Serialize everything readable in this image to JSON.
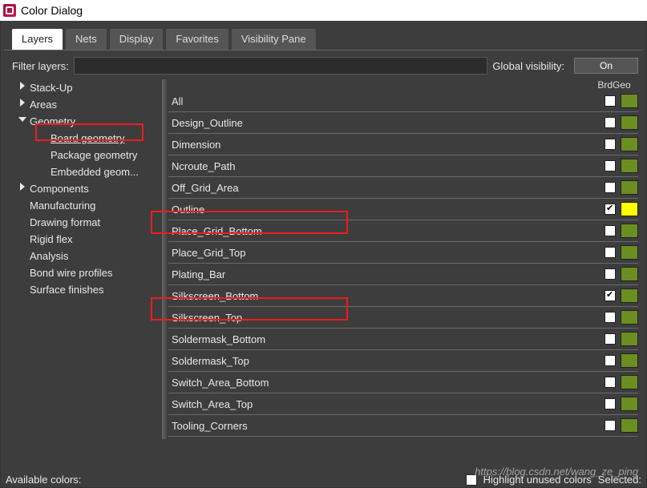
{
  "window": {
    "title": "Color Dialog"
  },
  "tabs": [
    "Layers",
    "Nets",
    "Display",
    "Favorites",
    "Visibility Pane"
  ],
  "active_tab": "Layers",
  "filter": {
    "label": "Filter layers:",
    "value": ""
  },
  "global_visibility": {
    "label": "Global visibility:",
    "button": "On"
  },
  "tree": [
    {
      "label": "Stack-Up",
      "arrow": "right",
      "level": 0
    },
    {
      "label": "Areas",
      "arrow": "right",
      "level": 0
    },
    {
      "label": "Geometry",
      "arrow": "down",
      "level": 0
    },
    {
      "label": "Board geometry",
      "arrow": "",
      "level": 1,
      "selected": true
    },
    {
      "label": "Package geometry",
      "arrow": "",
      "level": 1
    },
    {
      "label": "Embedded geom...",
      "arrow": "",
      "level": 1
    },
    {
      "label": "Components",
      "arrow": "right",
      "level": 0
    },
    {
      "label": "Manufacturing",
      "arrow": "",
      "level": 0
    },
    {
      "label": "Drawing format",
      "arrow": "",
      "level": 0
    },
    {
      "label": "Rigid flex",
      "arrow": "",
      "level": 0
    },
    {
      "label": "Analysis",
      "arrow": "",
      "level": 0
    },
    {
      "label": "Bond wire profiles",
      "arrow": "",
      "level": 0
    },
    {
      "label": "Surface finishes",
      "arrow": "",
      "level": 0
    }
  ],
  "column_header": "BrdGeo",
  "layers": [
    {
      "name": "All",
      "color": "#6b8e23",
      "checked": false
    },
    {
      "name": "Design_Outline",
      "color": "#6b8e23",
      "checked": false
    },
    {
      "name": "Dimension",
      "color": "#6b8e23",
      "checked": false
    },
    {
      "name": "Ncroute_Path",
      "color": "#6b8e23",
      "checked": false
    },
    {
      "name": "Off_Grid_Area",
      "color": "#6b8e23",
      "checked": false
    },
    {
      "name": "Outline",
      "color": "#ffff00",
      "checked": true
    },
    {
      "name": "Place_Grid_Bottom",
      "color": "#6b8e23",
      "checked": false
    },
    {
      "name": "Place_Grid_Top",
      "color": "#6b8e23",
      "checked": false
    },
    {
      "name": "Plating_Bar",
      "color": "#6b8e23",
      "checked": false
    },
    {
      "name": "Silkscreen_Bottom",
      "color": "#6b8e23",
      "checked": true
    },
    {
      "name": "Silkscreen_Top",
      "color": "#6b8e23",
      "checked": false
    },
    {
      "name": "Soldermask_Bottom",
      "color": "#6b8e23",
      "checked": false
    },
    {
      "name": "Soldermask_Top",
      "color": "#6b8e23",
      "checked": false
    },
    {
      "name": "Switch_Area_Bottom",
      "color": "#6b8e23",
      "checked": false
    },
    {
      "name": "Switch_Area_Top",
      "color": "#6b8e23",
      "checked": false
    },
    {
      "name": "Tooling_Corners",
      "color": "#6b8e23",
      "checked": false
    }
  ],
  "bottom": {
    "available": "Available colors:",
    "highlight": "Highlight unused colors",
    "selected": "Selected:"
  },
  "watermark": "https://blog.csdn.net/wang_ze_ping"
}
